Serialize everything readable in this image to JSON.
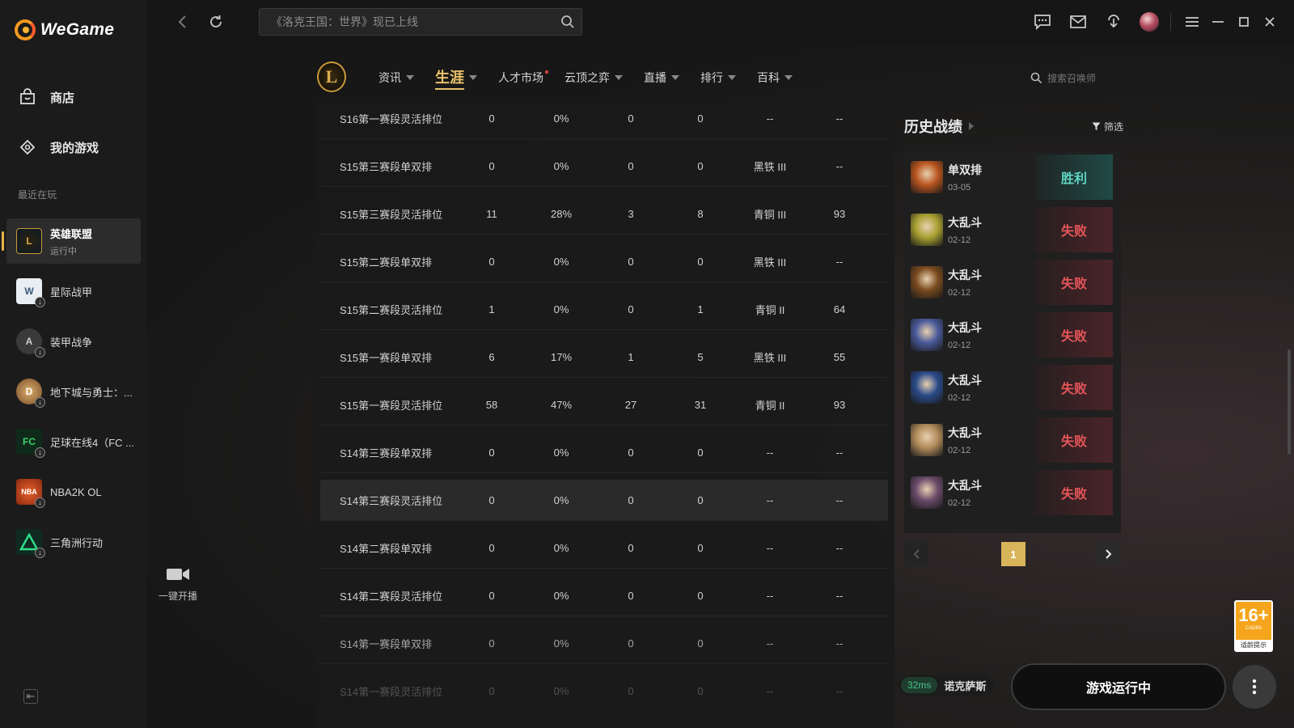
{
  "app": {
    "name": "WeGame",
    "colors": {
      "accent_gold": "#e8c16a",
      "win": "#5fd6c4",
      "lose": "#e6555a",
      "ping_green": "#49c58a",
      "age_orange": "#f4a51c"
    }
  },
  "sidebar": {
    "nav": [
      {
        "label": "商店",
        "icon": "store-bag-icon"
      },
      {
        "label": "我的游戏",
        "icon": "gamepad-icon"
      }
    ],
    "recent_label": "最近在玩",
    "games": [
      {
        "name": "英雄联盟",
        "status": "运行中",
        "active": true,
        "icon": "lol-game-icon"
      },
      {
        "name": "星际战甲",
        "status": "",
        "icon": "warframe-game-icon"
      },
      {
        "name": "装甲战争",
        "status": "",
        "icon": "armored-warfare-game-icon"
      },
      {
        "name": "地下城与勇士：...",
        "status": "",
        "icon": "dnf-game-icon"
      },
      {
        "name": "足球在线4（FC ...",
        "status": "",
        "icon": "fc-online-game-icon"
      },
      {
        "name": "NBA2K OL",
        "status": "",
        "icon": "nba2k-game-icon"
      },
      {
        "name": "三角洲行动",
        "status": "",
        "icon": "delta-force-game-icon"
      }
    ]
  },
  "topbar": {
    "search_placeholder": "《洛克王国：世界》现已上线"
  },
  "game_nav": {
    "items": [
      {
        "label": "资讯",
        "caret": true
      },
      {
        "label": "生涯",
        "caret": true,
        "active": true
      },
      {
        "label": "人才市场",
        "caret": false,
        "dot": true
      },
      {
        "label": "云顶之弈",
        "caret": true
      },
      {
        "label": "直播",
        "caret": true
      },
      {
        "label": "排行",
        "caret": true
      },
      {
        "label": "百科",
        "caret": true
      }
    ],
    "search_placeholder": "搜索召唤师"
  },
  "career_table": {
    "rows": [
      [
        "S16第一赛段灵活排位",
        "0",
        "0%",
        "0",
        "0",
        "--",
        "--"
      ],
      [
        "S15第三赛段单双排",
        "0",
        "0%",
        "0",
        "0",
        "黑铁 III",
        "--"
      ],
      [
        "S15第三赛段灵活排位",
        "11",
        "28%",
        "3",
        "8",
        "青铜 III",
        "93"
      ],
      [
        "S15第二赛段单双排",
        "0",
        "0%",
        "0",
        "0",
        "黑铁 III",
        "--"
      ],
      [
        "S15第二赛段灵活排位",
        "1",
        "0%",
        "0",
        "1",
        "青铜 II",
        "64"
      ],
      [
        "S15第一赛段单双排",
        "6",
        "17%",
        "1",
        "5",
        "黑铁 III",
        "55"
      ],
      [
        "S15第一赛段灵活排位",
        "58",
        "47%",
        "27",
        "31",
        "青铜 II",
        "93"
      ],
      [
        "S14第三赛段单双排",
        "0",
        "0%",
        "0",
        "0",
        "--",
        "--"
      ],
      [
        "S14第三赛段灵活排位",
        "0",
        "0%",
        "0",
        "0",
        "--",
        "--"
      ],
      [
        "S14第二赛段单双排",
        "0",
        "0%",
        "0",
        "0",
        "--",
        "--"
      ],
      [
        "S14第二赛段灵活排位",
        "0",
        "0%",
        "0",
        "0",
        "--",
        "--"
      ],
      [
        "S14第一赛段单双排",
        "0",
        "0%",
        "0",
        "0",
        "--",
        "--"
      ],
      [
        "S14第一赛段灵活排位",
        "0",
        "0%",
        "0",
        "0",
        "--",
        "--"
      ]
    ]
  },
  "history": {
    "title": "历史战绩",
    "filter_label": "筛选",
    "matches": [
      {
        "mode": "单双排",
        "date": "03-05",
        "result": "胜利",
        "win": true,
        "champ_color": "#b8541e"
      },
      {
        "mode": "大乱斗",
        "date": "02-12",
        "result": "失败",
        "win": false,
        "champ_color": "#a8a031"
      },
      {
        "mode": "大乱斗",
        "date": "02-12",
        "result": "失败",
        "win": false,
        "champ_color": "#7a4a1e"
      },
      {
        "mode": "大乱斗",
        "date": "02-12",
        "result": "失败",
        "win": false,
        "champ_color": "#4a5a9a"
      },
      {
        "mode": "大乱斗",
        "date": "02-12",
        "result": "失败",
        "win": false,
        "champ_color": "#2a4a8a"
      },
      {
        "mode": "大乱斗",
        "date": "02-12",
        "result": "失败",
        "win": false,
        "champ_color": "#b08a5a"
      },
      {
        "mode": "大乱斗",
        "date": "02-12",
        "result": "失败",
        "win": false,
        "champ_color": "#6a4a6a"
      }
    ],
    "page": "1"
  },
  "bottom": {
    "broadcast_label": "一键开播",
    "ping": "32ms",
    "server": "诺克萨斯",
    "play_label": "游戏运行中",
    "age_rating": "16+",
    "age_sub": "CADPA",
    "age_tip": "适龄提示"
  }
}
